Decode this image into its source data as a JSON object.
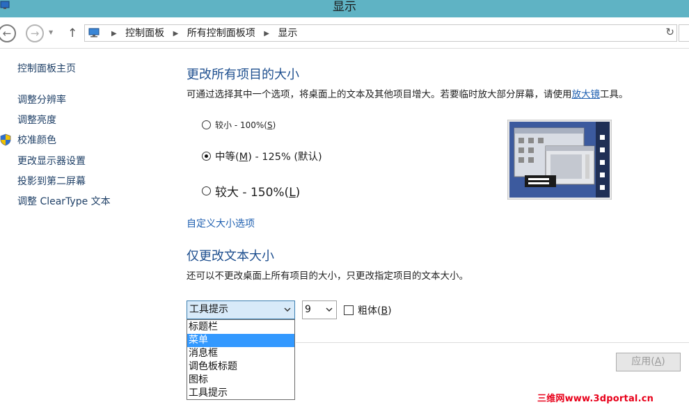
{
  "window": {
    "title": "显示"
  },
  "nav": {
    "back_icon": "back-arrow-icon",
    "forward_icon": "forward-arrow-icon",
    "up_icon": "up-arrow-icon",
    "breadcrumb": [
      "控制面板",
      "所有控制面板项",
      "显示"
    ],
    "refresh_icon": "refresh-icon"
  },
  "sidebar": {
    "home": "控制面板主页",
    "links": [
      "调整分辨率",
      "调整亮度",
      "校准颜色",
      "更改显示器设置",
      "投影到第二屏幕",
      "调整 ClearType 文本"
    ]
  },
  "main": {
    "heading1": "更改所有项目的大小",
    "desc1_before": "可通过选择其中一个选项，将桌面上的文本及其他项目增大。若要临时放大部分屏幕，请使用",
    "desc1_link": "放大镜",
    "desc1_after": "工具。",
    "size_options": [
      {
        "label_pre": "较小 - 100%(",
        "key": "S",
        "label_post": ")",
        "selected": false
      },
      {
        "label_pre": "中等(",
        "key": "M",
        "label_post": ") - 125% (默认)",
        "selected": true
      },
      {
        "label_pre": "较大 - 150%(",
        "key": "L",
        "label_post": ")",
        "selected": false
      }
    ],
    "custom_link": "自定义大小选项",
    "heading2": "仅更改文本大小",
    "desc2": "还可以不更改桌面上所有项目的大小，只更改指定项目的文本大小。",
    "item_select": {
      "value": "工具提示",
      "options": [
        "标题栏",
        "菜单",
        "消息框",
        "调色板标题",
        "图标",
        "工具提示"
      ],
      "highlighted": "菜单"
    },
    "size_select": {
      "value": "9"
    },
    "bold": {
      "label_pre": "粗体(",
      "key": "B",
      "label_post": ")",
      "checked": false
    },
    "apply": {
      "label_pre": "应用(",
      "key": "A",
      "label_post": ")",
      "enabled": false
    }
  },
  "watermark": "三维网www.3dportal.cn",
  "colors": {
    "titlebar": "#5fb3c4",
    "heading": "#1e4f8f",
    "link": "#1e5fb0",
    "selection": "#3399ff",
    "watermark": "#e8001a"
  }
}
